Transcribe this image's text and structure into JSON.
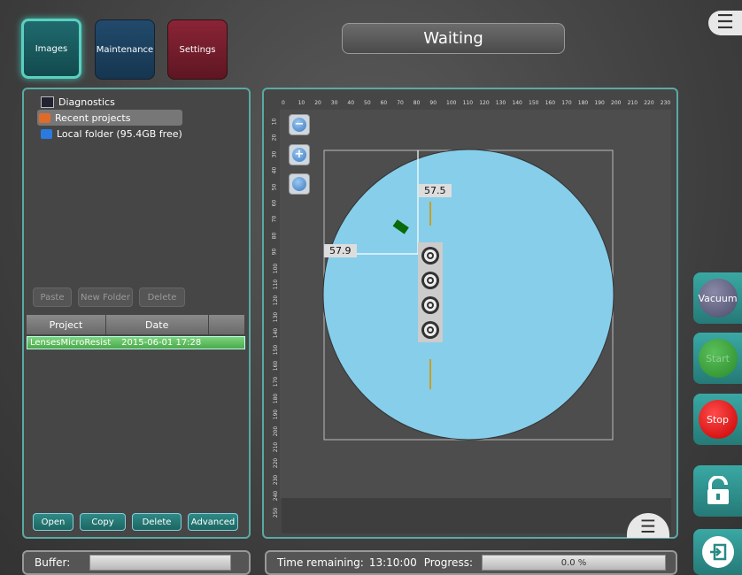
{
  "nav": {
    "images_label": "Images",
    "maintenance_label": "Maintenance",
    "settings_label": "Settings"
  },
  "status": {
    "text": "Waiting"
  },
  "tree": {
    "items": [
      {
        "label": "Diagnostics",
        "icon": "diagnostics-icon"
      },
      {
        "label": "Recent projects",
        "icon": "recent-folder-icon"
      },
      {
        "label": "Local folder (95.4GB free)",
        "icon": "folder-icon"
      }
    ]
  },
  "file_actions": {
    "paste": "Paste",
    "new_folder": "New Folder",
    "delete": "Delete"
  },
  "table": {
    "headers": [
      "Project",
      "Date",
      ""
    ],
    "rows": [
      {
        "project": "LensesMicroResist",
        "date": "2015-06-01 17:28"
      }
    ]
  },
  "project_actions": {
    "open": "Open",
    "copy": "Copy",
    "delete": "Delete",
    "advanced": "Advanced"
  },
  "ruler": {
    "x_ticks": [
      "0",
      "10",
      "20",
      "30",
      "40",
      "50",
      "60",
      "70",
      "80",
      "90",
      "100",
      "110",
      "120",
      "130",
      "140",
      "150",
      "160",
      "170",
      "180",
      "190",
      "200",
      "210",
      "220",
      "230"
    ],
    "y_ticks": [
      "10",
      "20",
      "30",
      "40",
      "50",
      "60",
      "70",
      "80",
      "90",
      "100",
      "110",
      "120",
      "130",
      "140",
      "150",
      "160",
      "170",
      "180",
      "190",
      "200",
      "210",
      "220",
      "230",
      "240",
      "250"
    ]
  },
  "map": {
    "label_x": "57.5",
    "label_y": "57.9",
    "wafer_color": "#87ceeb",
    "lens_count": 4
  },
  "side": {
    "vacuum": "Vacuum",
    "start": "Start",
    "stop": "Stop"
  },
  "bottom": {
    "buffer_label": "Buffer:",
    "time_label": "Time remaining:",
    "time_value": "13:10:00",
    "progress_label": "Progress:",
    "progress_value": "0.0 %",
    "progress_fraction": 0.0
  }
}
